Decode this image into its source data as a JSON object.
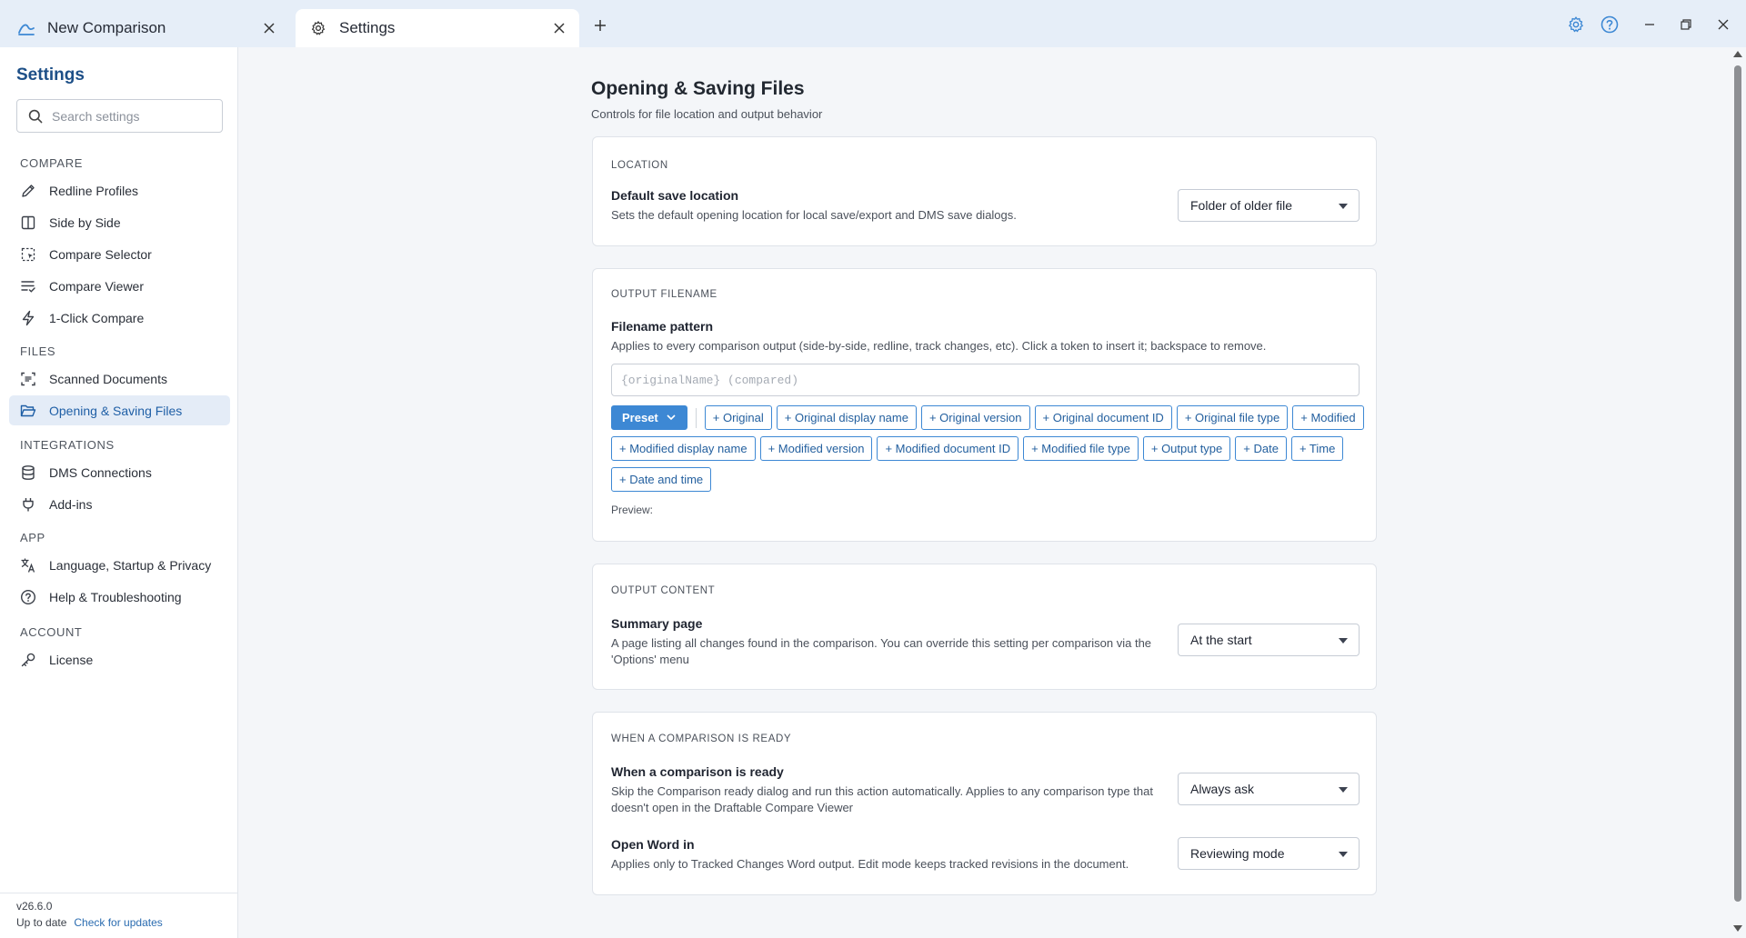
{
  "tabs": [
    {
      "label": "New Comparison",
      "icon": "draftable-logo-icon"
    },
    {
      "label": "Settings",
      "icon": "gear-icon"
    }
  ],
  "window_controls": [
    "gear-icon",
    "help-icon",
    "minimize-icon",
    "restore-icon",
    "close-icon"
  ],
  "sidebar": {
    "title": "Settings",
    "search_placeholder": "Search settings",
    "groups": {
      "compare": "COMPARE",
      "files": "FILES",
      "integrations": "INTEGRATIONS",
      "app": "APP",
      "account": "ACCOUNT"
    },
    "items": {
      "redline_profiles": "Redline Profiles",
      "side_by_side": "Side by Side",
      "compare_selector": "Compare Selector",
      "compare_viewer": "Compare Viewer",
      "one_click_compare": "1-Click Compare",
      "scanned_documents": "Scanned Documents",
      "opening_saving_files": "Opening & Saving Files",
      "dms_connections": "DMS Connections",
      "add_ins": "Add-ins",
      "language_startup_privacy": "Language, Startup & Privacy",
      "help_troubleshooting": "Help & Troubleshooting",
      "license": "License"
    },
    "active_item": "Opening & Saving Files",
    "version": "v26.6.0",
    "update_status": "Up to date",
    "check_updates": "Check for updates"
  },
  "main": {
    "title": "Opening & Saving Files",
    "subtitle": "Controls for file location and output behavior",
    "location": {
      "section_label": "LOCATION",
      "title": "Default save location",
      "description": "Sets the default opening location for local save/export and DMS save dialogs.",
      "value": "Folder of older file"
    },
    "output_filename": {
      "section_label": "OUTPUT FILENAME",
      "title": "Filename pattern",
      "description": "Applies to every comparison output (side-by-side, redline, track changes, etc). Click a token to insert it; backspace to remove.",
      "placeholder": "{originalName} (compared)",
      "preset_label": "Preset",
      "tokens": [
        "+ Original",
        "+ Original display name",
        "+ Original version",
        "+ Original document ID",
        "+ Original file type",
        "+ Modified",
        "+ Modified display name",
        "+ Modified version",
        "+ Modified document ID",
        "+ Modified file type",
        "+ Output type",
        "+ Date",
        "+ Time",
        "+ Date and time"
      ],
      "preview_label": "Preview:"
    },
    "output_content": {
      "section_label": "OUTPUT CONTENT",
      "title": "Summary page",
      "description": "A page listing all changes found in the comparison. You can override this setting per comparison via the 'Options' menu",
      "value": "At the start"
    },
    "when_ready": {
      "section_label": "WHEN A COMPARISON IS READY",
      "title": "When a comparison is ready",
      "description": "Skip the Comparison ready dialog and run this action automatically. Applies to any comparison type that doesn't open in the Draftable Compare Viewer",
      "value": "Always ask",
      "word_title": "Open Word in",
      "word_description": "Applies only to Tracked Changes Word output. Edit mode keeps tracked revisions in the document.",
      "word_value": "Reviewing mode"
    }
  },
  "colors": {
    "accent": "#3d88d4",
    "sidebar_title": "#1d4f87",
    "active_nav_bg": "#e4ecf7",
    "tabbar_bg": "#e6eef8",
    "page_bg": "#f4f6f9"
  }
}
